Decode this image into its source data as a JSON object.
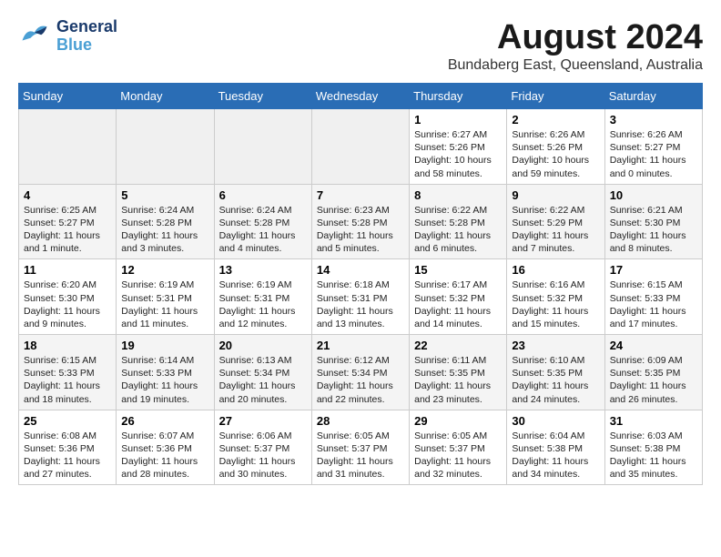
{
  "logo": {
    "line1": "General",
    "line2": "Blue"
  },
  "title": "August 2024",
  "location": "Bundaberg East, Queensland, Australia",
  "weekdays": [
    "Sunday",
    "Monday",
    "Tuesday",
    "Wednesday",
    "Thursday",
    "Friday",
    "Saturday"
  ],
  "weeks": [
    [
      {
        "day": "",
        "empty": true
      },
      {
        "day": "",
        "empty": true
      },
      {
        "day": "",
        "empty": true
      },
      {
        "day": "",
        "empty": true
      },
      {
        "day": "1",
        "sunrise": "6:27 AM",
        "sunset": "5:26 PM",
        "daylight": "10 hours and 58 minutes."
      },
      {
        "day": "2",
        "sunrise": "6:26 AM",
        "sunset": "5:26 PM",
        "daylight": "10 hours and 59 minutes."
      },
      {
        "day": "3",
        "sunrise": "6:26 AM",
        "sunset": "5:27 PM",
        "daylight": "11 hours and 0 minutes."
      }
    ],
    [
      {
        "day": "4",
        "sunrise": "6:25 AM",
        "sunset": "5:27 PM",
        "daylight": "11 hours and 1 minute."
      },
      {
        "day": "5",
        "sunrise": "6:24 AM",
        "sunset": "5:28 PM",
        "daylight": "11 hours and 3 minutes."
      },
      {
        "day": "6",
        "sunrise": "6:24 AM",
        "sunset": "5:28 PM",
        "daylight": "11 hours and 4 minutes."
      },
      {
        "day": "7",
        "sunrise": "6:23 AM",
        "sunset": "5:28 PM",
        "daylight": "11 hours and 5 minutes."
      },
      {
        "day": "8",
        "sunrise": "6:22 AM",
        "sunset": "5:28 PM",
        "daylight": "11 hours and 6 minutes."
      },
      {
        "day": "9",
        "sunrise": "6:22 AM",
        "sunset": "5:29 PM",
        "daylight": "11 hours and 7 minutes."
      },
      {
        "day": "10",
        "sunrise": "6:21 AM",
        "sunset": "5:30 PM",
        "daylight": "11 hours and 8 minutes."
      }
    ],
    [
      {
        "day": "11",
        "sunrise": "6:20 AM",
        "sunset": "5:30 PM",
        "daylight": "11 hours and 9 minutes."
      },
      {
        "day": "12",
        "sunrise": "6:19 AM",
        "sunset": "5:31 PM",
        "daylight": "11 hours and 11 minutes."
      },
      {
        "day": "13",
        "sunrise": "6:19 AM",
        "sunset": "5:31 PM",
        "daylight": "11 hours and 12 minutes."
      },
      {
        "day": "14",
        "sunrise": "6:18 AM",
        "sunset": "5:31 PM",
        "daylight": "11 hours and 13 minutes."
      },
      {
        "day": "15",
        "sunrise": "6:17 AM",
        "sunset": "5:32 PM",
        "daylight": "11 hours and 14 minutes."
      },
      {
        "day": "16",
        "sunrise": "6:16 AM",
        "sunset": "5:32 PM",
        "daylight": "11 hours and 15 minutes."
      },
      {
        "day": "17",
        "sunrise": "6:15 AM",
        "sunset": "5:33 PM",
        "daylight": "11 hours and 17 minutes."
      }
    ],
    [
      {
        "day": "18",
        "sunrise": "6:15 AM",
        "sunset": "5:33 PM",
        "daylight": "11 hours and 18 minutes."
      },
      {
        "day": "19",
        "sunrise": "6:14 AM",
        "sunset": "5:33 PM",
        "daylight": "11 hours and 19 minutes."
      },
      {
        "day": "20",
        "sunrise": "6:13 AM",
        "sunset": "5:34 PM",
        "daylight": "11 hours and 20 minutes."
      },
      {
        "day": "21",
        "sunrise": "6:12 AM",
        "sunset": "5:34 PM",
        "daylight": "11 hours and 22 minutes."
      },
      {
        "day": "22",
        "sunrise": "6:11 AM",
        "sunset": "5:35 PM",
        "daylight": "11 hours and 23 minutes."
      },
      {
        "day": "23",
        "sunrise": "6:10 AM",
        "sunset": "5:35 PM",
        "daylight": "11 hours and 24 minutes."
      },
      {
        "day": "24",
        "sunrise": "6:09 AM",
        "sunset": "5:35 PM",
        "daylight": "11 hours and 26 minutes."
      }
    ],
    [
      {
        "day": "25",
        "sunrise": "6:08 AM",
        "sunset": "5:36 PM",
        "daylight": "11 hours and 27 minutes."
      },
      {
        "day": "26",
        "sunrise": "6:07 AM",
        "sunset": "5:36 PM",
        "daylight": "11 hours and 28 minutes."
      },
      {
        "day": "27",
        "sunrise": "6:06 AM",
        "sunset": "5:37 PM",
        "daylight": "11 hours and 30 minutes."
      },
      {
        "day": "28",
        "sunrise": "6:05 AM",
        "sunset": "5:37 PM",
        "daylight": "11 hours and 31 minutes."
      },
      {
        "day": "29",
        "sunrise": "6:05 AM",
        "sunset": "5:37 PM",
        "daylight": "11 hours and 32 minutes."
      },
      {
        "day": "30",
        "sunrise": "6:04 AM",
        "sunset": "5:38 PM",
        "daylight": "11 hours and 34 minutes."
      },
      {
        "day": "31",
        "sunrise": "6:03 AM",
        "sunset": "5:38 PM",
        "daylight": "11 hours and 35 minutes."
      }
    ]
  ],
  "labels": {
    "sunrise": "Sunrise:",
    "sunset": "Sunset:",
    "daylight": "Daylight:"
  }
}
